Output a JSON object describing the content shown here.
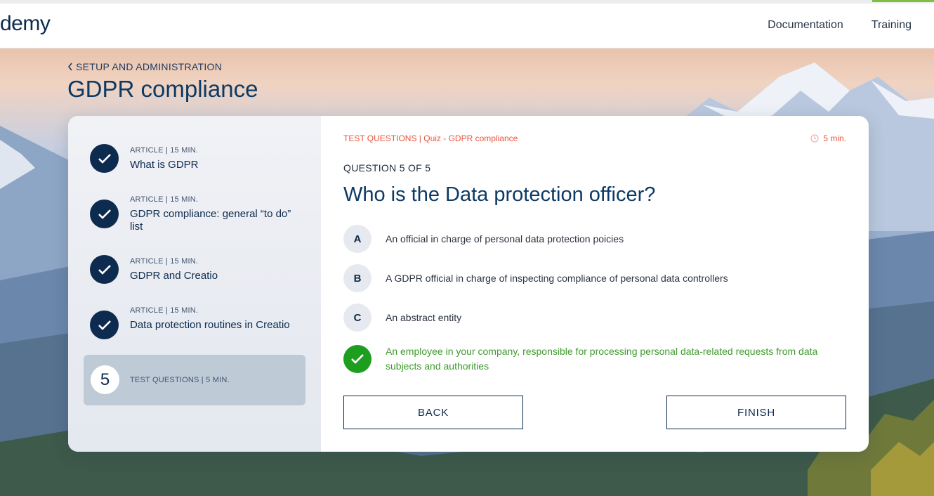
{
  "header": {
    "logo": "demy",
    "nav": [
      "Documentation",
      "Training"
    ]
  },
  "breadcrumb": "SETUP AND ADMINISTRATION",
  "page_title": "GDPR compliance",
  "lessons": [
    {
      "meta": "ARTICLE | 15 MIN.",
      "title": "What is GDPR",
      "status": "completed"
    },
    {
      "meta": "ARTICLE | 15 MIN.",
      "title": "GDPR compliance: general “to do” list",
      "status": "completed"
    },
    {
      "meta": "ARTICLE | 15 MIN.",
      "title": "GDPR and Creatio",
      "status": "completed"
    },
    {
      "meta": "ARTICLE | 15 MIN.",
      "title": "Data protection routines in Creatio",
      "status": "completed"
    },
    {
      "number": "5",
      "meta": "TEST QUESTIONS | 5 MIN.",
      "status": "active"
    }
  ],
  "quiz": {
    "crumb": "TEST QUESTIONS | Quiz - GDPR compliance",
    "timer": "5 min.",
    "counter": "QUESTION 5 OF 5",
    "question": "Who is the Data protection officer?",
    "options": [
      {
        "letter": "A",
        "text": "An official in charge of personal data protection poicies",
        "state": "default"
      },
      {
        "letter": "B",
        "text": "A GDPR official in charge of inspecting compliance of personal data controllers",
        "state": "default"
      },
      {
        "letter": "C",
        "text": "An abstract entity",
        "state": "default"
      },
      {
        "letter": "",
        "text": "An employee in your company, responsible for processing personal data-related requests from data subjects and authorities",
        "state": "correct"
      }
    ],
    "back_label": "BACK",
    "finish_label": "FINISH"
  },
  "colors": {
    "brand_navy": "#0d2b4e",
    "accent_red": "#e8543f",
    "correct_green": "#1e9e1e"
  }
}
